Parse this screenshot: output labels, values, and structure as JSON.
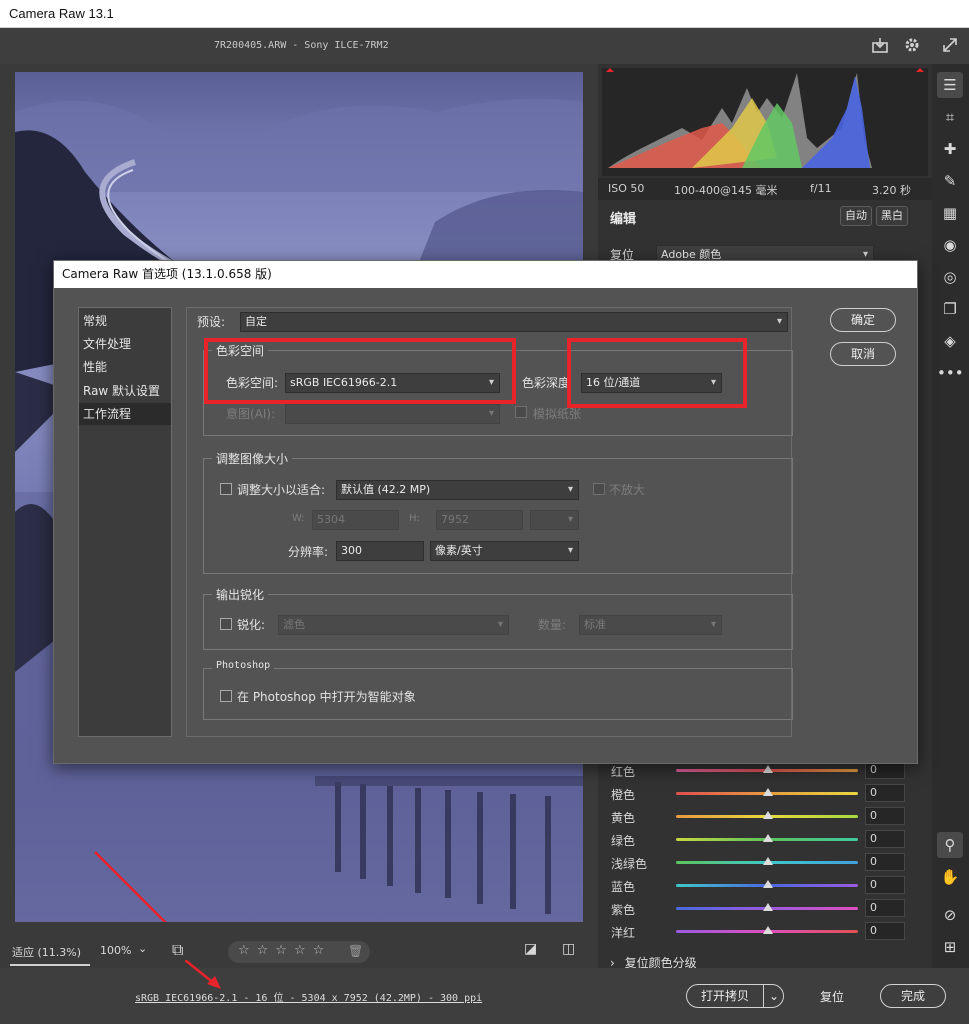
{
  "window": {
    "title": "Camera Raw 13.1"
  },
  "topbar": {
    "file_info": "7R200405.ARW  -  Sony ILCE-7RM2",
    "save_icon": "save-icon",
    "settings_icon": "gear-icon",
    "fullscreen_icon": "expand-icon"
  },
  "panel": {
    "exif": {
      "iso": "ISO 50",
      "lens": "100-400@145 毫米",
      "aperture": "f/11",
      "shutter": "3.20 秒"
    },
    "edit_title": "编辑",
    "auto_button": "自动",
    "bw_button": "黑白",
    "profile_label": "复位",
    "profile_value": "Adobe 颜色",
    "hsl_rows": [
      {
        "label": "红色",
        "value": "0",
        "color": "#e05050"
      },
      {
        "label": "橙色",
        "value": "0",
        "color": "#e89a40"
      },
      {
        "label": "黄色",
        "value": "0",
        "color": "#e8d840"
      },
      {
        "label": "绿色",
        "value": "0",
        "color": "#5cc45c"
      },
      {
        "label": "浅绿色",
        "value": "0",
        "color": "#40c8c8"
      },
      {
        "label": "蓝色",
        "value": "0",
        "color": "#4a6ae0"
      },
      {
        "label": "紫色",
        "value": "0",
        "color": "#9a5ae0"
      },
      {
        "label": "洋红",
        "value": "0",
        "color": "#e050c0"
      }
    ],
    "next_section": "复位颜色分级"
  },
  "viewbar": {
    "fit_label": "适应 (11.3%)",
    "zoom_value": "100%"
  },
  "statusbar": {
    "workflow_link": "sRGB IEC61966-2.1 - 16 位 - 5304 x 7952 (42.2MP) - 300 ppi",
    "open_copy": "打开拷贝",
    "reset": "复位",
    "done": "完成"
  },
  "dialog": {
    "title": "Camera Raw 首选项  (13.1.0.658 版)",
    "nav": [
      "常规",
      "文件处理",
      "性能",
      "Raw 默认设置",
      "工作流程"
    ],
    "active_nav": "工作流程",
    "ok_button": "确定",
    "cancel_button": "取消",
    "preset_label": "预设:",
    "preset_value": "自定",
    "color_space": {
      "group_title": "色彩空间",
      "space_label": "色彩空间:",
      "space_value": "sRGB IEC61966-2.1",
      "depth_label": "色彩深度",
      "depth_value": "16 位/通道",
      "intent_label": "意图(AI):",
      "intent_value": "",
      "simulate_paper_label": "模拟纸张"
    },
    "resize": {
      "group_title": "调整图像大小",
      "fit_label": "调整大小以适合:",
      "fit_value": "默认值 (42.2 MP)",
      "no_enlarge_label": "不放大",
      "w_label": "W:",
      "w_value": "5304",
      "h_label": "H:",
      "h_value": "7952",
      "unit_value": "",
      "resolution_label": "分辨率:",
      "resolution_value": "300",
      "resolution_unit": "像素/英寸"
    },
    "sharpen": {
      "group_title": "输出锐化",
      "sharpen_label": "锐化:",
      "sharpen_value": "滤色",
      "amount_label": "数量:",
      "amount_value": "标准"
    },
    "photoshop": {
      "group_title": "Photoshop",
      "smart_object_label": "在 Photoshop 中打开为智能对象"
    }
  },
  "annotation_color": "#e8232a"
}
